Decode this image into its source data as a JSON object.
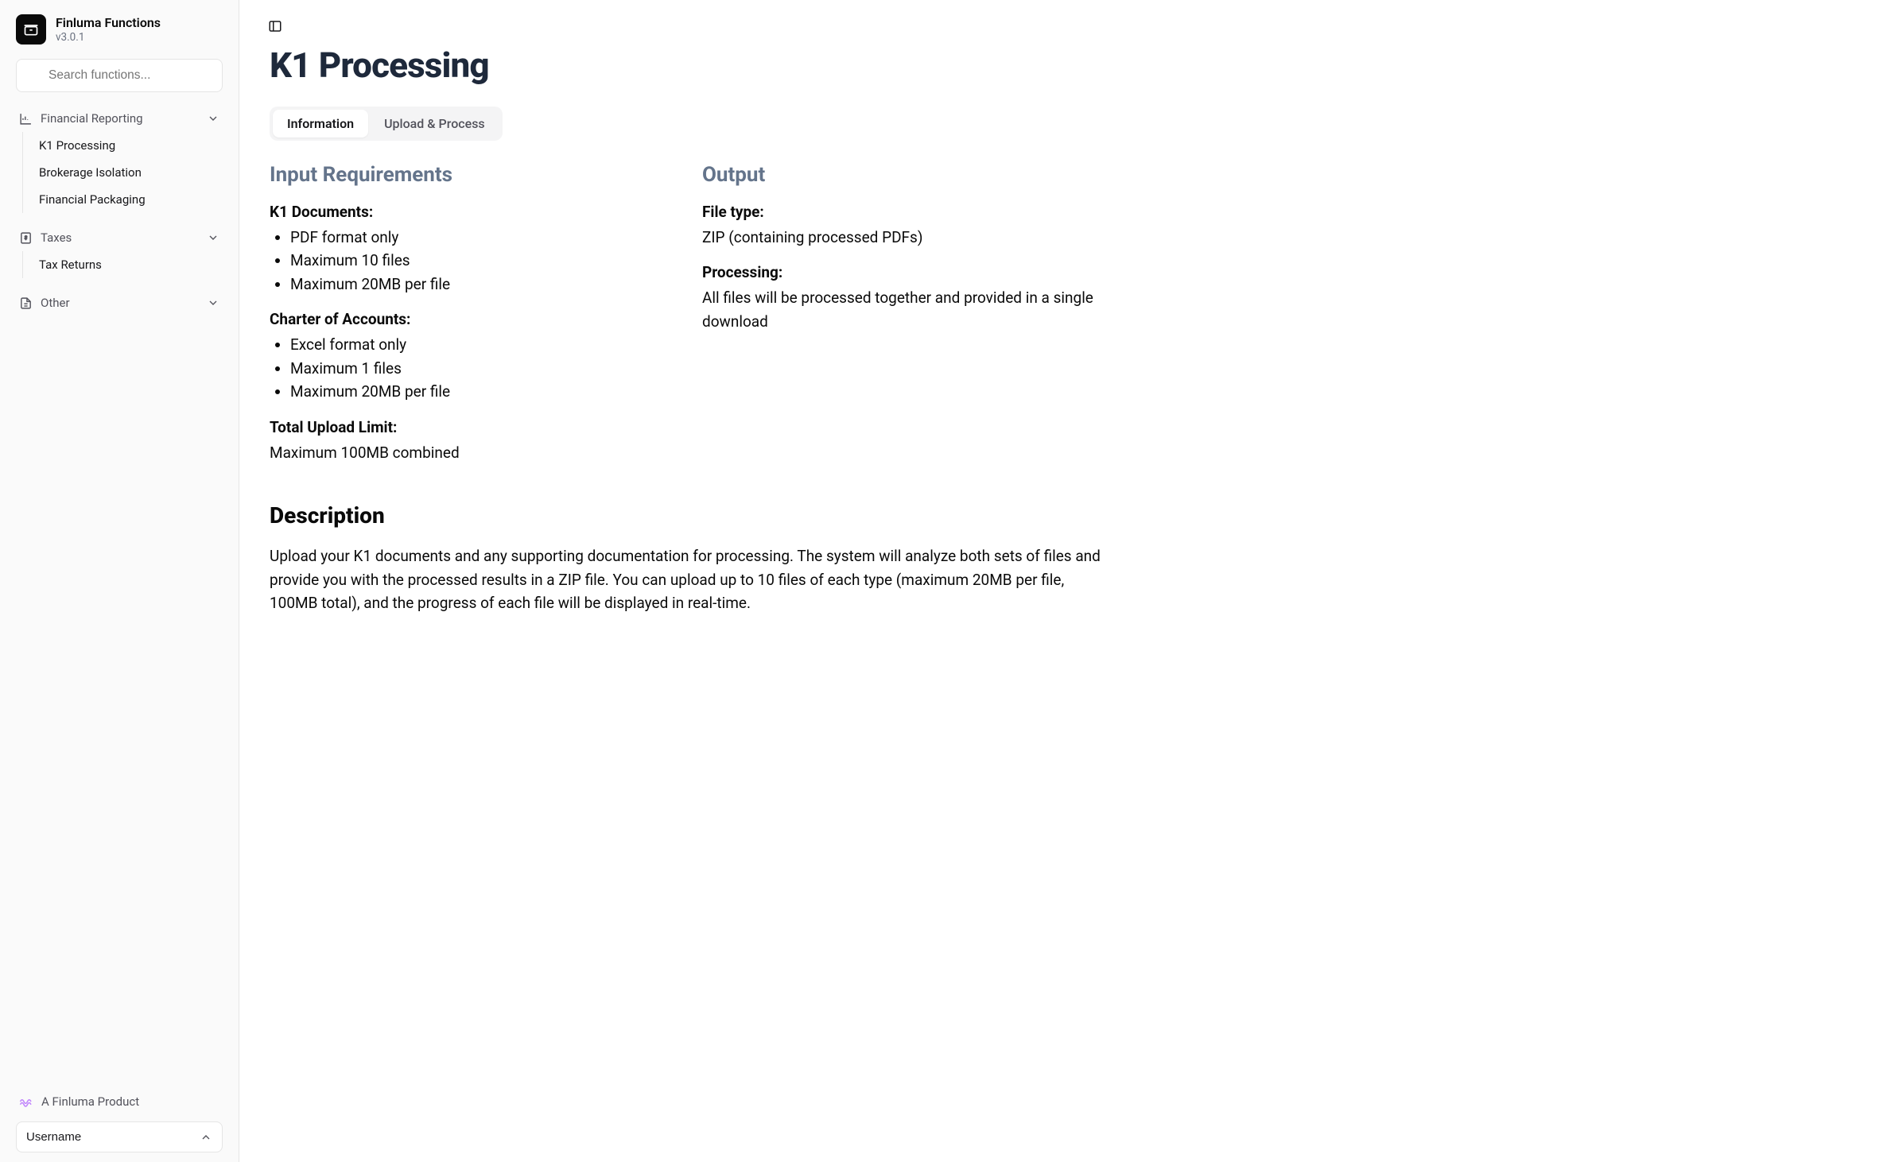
{
  "app": {
    "name": "Finluma Functions",
    "version": "v3.0.1"
  },
  "search": {
    "placeholder": "Search functions..."
  },
  "nav": {
    "groups": [
      {
        "label": "Financial Reporting",
        "items": [
          {
            "label": "K1 Processing"
          },
          {
            "label": "Brokerage Isolation"
          },
          {
            "label": "Financial Packaging"
          }
        ]
      },
      {
        "label": "Taxes",
        "items": [
          {
            "label": "Tax Returns"
          }
        ]
      },
      {
        "label": "Other",
        "items": []
      }
    ]
  },
  "footer": {
    "product_line": "A Finluma Product",
    "username": "Username"
  },
  "page": {
    "title": "K1 Processing",
    "tabs": [
      {
        "label": "Information"
      },
      {
        "label": "Upload & Process"
      }
    ],
    "input_heading": "Input Requirements",
    "k1_docs": {
      "heading": "K1 Documents:",
      "items": [
        "PDF format only",
        "Maximum 10 files",
        "Maximum 20MB per file"
      ]
    },
    "charter": {
      "heading": "Charter of Accounts:",
      "items": [
        "Excel format only",
        "Maximum 1 files",
        "Maximum 20MB per file"
      ]
    },
    "total_limit": {
      "heading": "Total Upload Limit:",
      "body": "Maximum 100MB combined"
    },
    "output": {
      "heading": "Output",
      "file_type_label": "File type:",
      "file_type_value": "ZIP (containing processed PDFs)",
      "processing_label": "Processing:",
      "processing_value": "All files will be processed together and provided in a single download"
    },
    "description": {
      "heading": "Description",
      "body": "Upload your K1 documents and any supporting documentation for processing. The system will analyze both sets of files and provide you with the processed results in a ZIP file. You can upload up to 10 files of each type (maximum 20MB per file, 100MB total), and the progress of each file will be displayed in real-time."
    }
  }
}
